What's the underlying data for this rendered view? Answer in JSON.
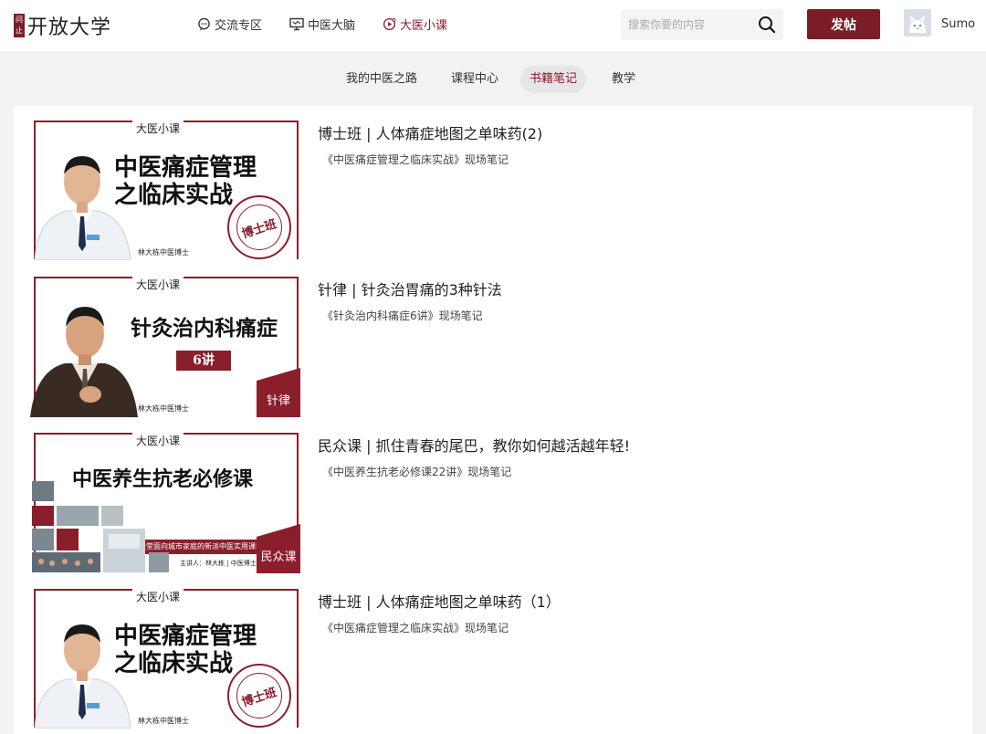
{
  "header": {
    "logo_seal": "问止",
    "logo_text": "开放大学",
    "nav": [
      {
        "label": "交流专区",
        "icon": "chat-bubble-icon"
      },
      {
        "label": "中医大脑",
        "icon": "monitor-icon"
      },
      {
        "label": "大医小课",
        "icon": "play-circle-icon"
      }
    ],
    "search_placeholder": "搜索你要的内容",
    "post_button": "发帖",
    "username": "Sumo"
  },
  "subnav": [
    "我的中医之路",
    "课程中心",
    "书籍笔记",
    "教学"
  ],
  "active_subnav": "书籍笔记",
  "colors": {
    "brand": "#7a1d26",
    "accent": "#8b1e2b",
    "page_bg": "#f2f2f2"
  },
  "thumb_common": {
    "header": "大医小课",
    "signature": "林大栋中医博士"
  },
  "items": [
    {
      "title": "博士班 | 人体痛症地图之单味药(2)",
      "subtitle": "《中医痛症管理之临床实战》现场笔记",
      "thumb_line1": "中医痛症管理",
      "thumb_line2": "之临床实战",
      "thumb_stamp": "博士班"
    },
    {
      "title": "针律 | 针灸治胃痛的3种针法",
      "subtitle": "《针灸治内科痛症6讲》现场笔记",
      "thumb_line1": "针灸治内科痛症",
      "thumb_badge": "6讲",
      "thumb_corner": "针律"
    },
    {
      "title": "民众课 | 抓住青春的尾巴，教你如何越活越年轻!",
      "subtitle": "《中医养生抗老必修课22讲》现场笔记",
      "thumb_line1": "中医养生抗老必修课",
      "thumb_banner": "这是一堂面向城市家庭的新派中医实用课程",
      "thumb_lecturer": "主讲人：林大栋 | 中医博士",
      "thumb_corner": "民众课"
    },
    {
      "title": "博士班 | 人体痛症地图之单味药（1）",
      "subtitle": "《中医痛症管理之临床实战》现场笔记",
      "thumb_line1": "中医痛症管理",
      "thumb_line2": "之临床实战",
      "thumb_stamp": "博士班"
    }
  ]
}
